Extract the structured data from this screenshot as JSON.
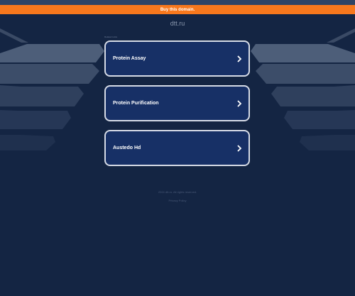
{
  "banner": {
    "label": "Buy this domain."
  },
  "domain": "dtt.ru",
  "related_label": "Related Links",
  "links": [
    {
      "label": "Protein Assay"
    },
    {
      "label": "Protein Purification"
    },
    {
      "label": "Austedo Hd"
    }
  ],
  "footer": {
    "copyright": "2024 dtt.ru. All rights reserved.",
    "privacy": "Privacy Policy"
  },
  "colors": {
    "background": "#142543",
    "banner": "#f7781d",
    "card": "#173066",
    "card_border": "#d6dbe6"
  }
}
